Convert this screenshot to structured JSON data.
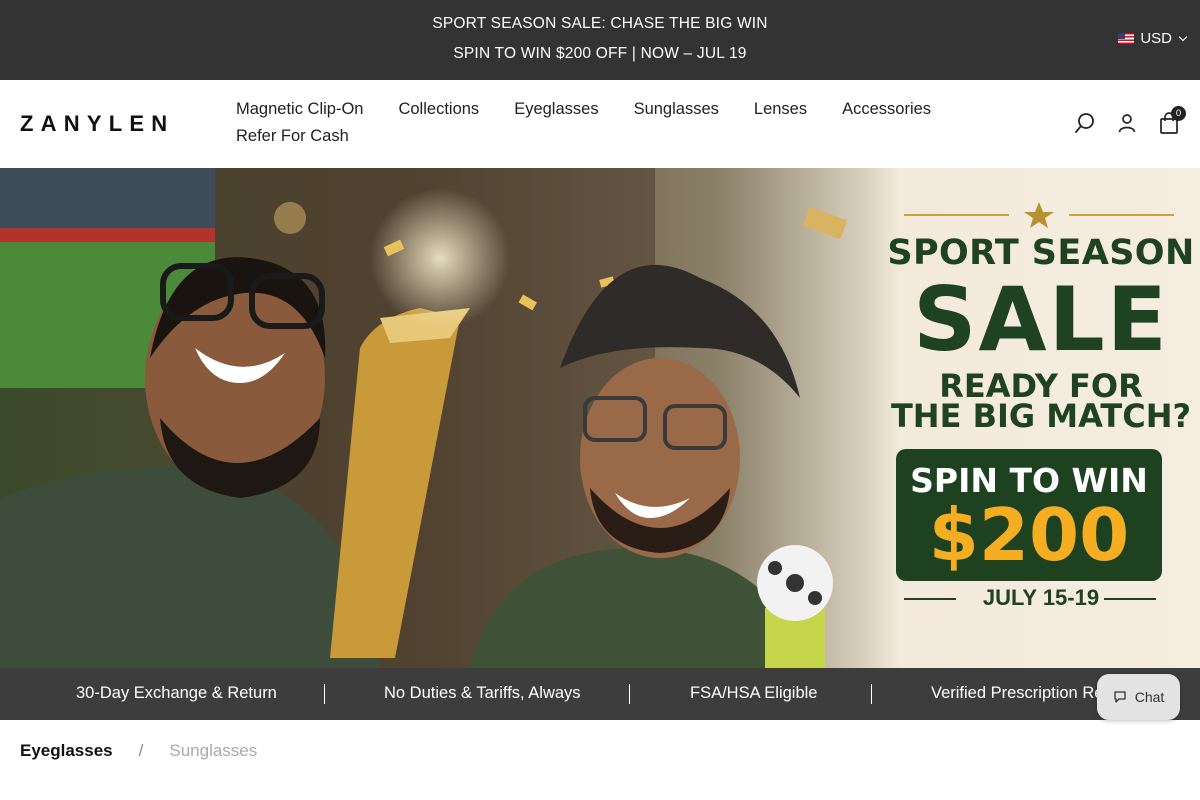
{
  "announcement": {
    "line1": "SPORT SEASON SALE: CHASE THE BIG WIN",
    "line2": "SPIN TO WIN $200 OFF | NOW – JUL 19",
    "currency": "USD"
  },
  "header": {
    "logo": "ZANYLEN",
    "nav": [
      "Magnetic Clip-On",
      "Collections",
      "Eyeglasses",
      "Sunglasses",
      "Lenses",
      "Accessories",
      "Refer For Cash"
    ],
    "cart_count": "0"
  },
  "hero": {
    "promo": {
      "line1": "SPORT SEASON",
      "line2": "SALE",
      "line3": "READY FOR",
      "line4": "THE BIG MATCH?",
      "spin": "SPIN TO WIN",
      "amount": "$200",
      "dates": "JULY 15-19"
    },
    "colors": {
      "green": "#1e4220",
      "gold": "#f5ae22",
      "cream": "#f3eadc"
    }
  },
  "benefits": [
    "30-Day Exchange & Return",
    "No Duties & Tariffs, Always",
    "FSA/HSA Eligible",
    "Verified Prescription Rec"
  ],
  "chat": {
    "label": "Chat"
  },
  "tabs": {
    "active": "Eyeglasses",
    "separator": "/",
    "inactive": "Sunglasses"
  }
}
